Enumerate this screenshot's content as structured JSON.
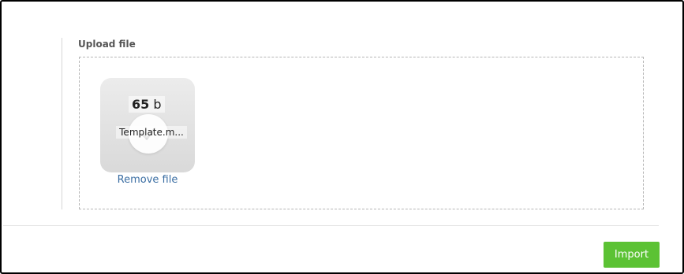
{
  "upload": {
    "label": "Upload file"
  },
  "file": {
    "size_value": "65",
    "size_unit": "b",
    "name": "Template.m...",
    "remove_label": "Remove file",
    "status_icon": "check-icon"
  },
  "footer": {
    "import_label": "Import"
  },
  "colors": {
    "accent": "#5cc234",
    "link": "#3b6ea3",
    "label": "#555555"
  }
}
